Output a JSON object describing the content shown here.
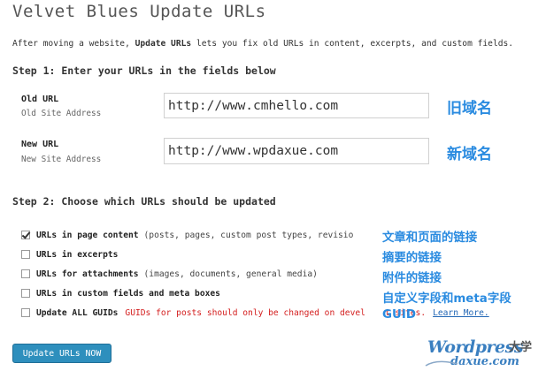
{
  "page": {
    "title": "Velvet Blues Update URLs",
    "intro_prefix": "After moving a website, ",
    "intro_bold": "Update URLs",
    "intro_suffix": " lets you fix old URLs in content, excerpts, and custom fields."
  },
  "step1": {
    "heading": "Step 1: Enter your URLs in the fields below",
    "old_url": {
      "label": "Old URL",
      "sub": "Old Site Address",
      "value": "http://www.cmhello.com",
      "annotation": "旧域名"
    },
    "new_url": {
      "label": "New URL",
      "sub": "New Site Address",
      "value": "http://www.wpdaxue.com",
      "annotation": "新域名"
    }
  },
  "step2": {
    "heading": "Step 2: Choose which URLs should be updated",
    "options": [
      {
        "bold": "URLs in page content",
        "desc": "(posts, pages, custom post types, revisio",
        "checked": true
      },
      {
        "bold": "URLs in excerpts",
        "desc": "",
        "checked": false
      },
      {
        "bold": "URLs for attachments",
        "desc": "(images, documents, general media)",
        "checked": false
      },
      {
        "bold": "URLs in custom fields and meta boxes",
        "desc": "",
        "checked": false
      },
      {
        "bold": "Update ALL GUIDs",
        "desc": "",
        "warn": "GUIDs for posts should only be changed on devel",
        "warn_tail": "t sites.",
        "link": "Learn More.",
        "checked": false
      }
    ],
    "annotations": [
      "文章和页面的链接",
      "摘要的链接",
      "附件的链接",
      "自定义字段和meta字段",
      "GUID"
    ]
  },
  "actions": {
    "submit_label": "Update URLs NOW"
  },
  "watermark": {
    "word1": "Wordpress",
    "word2": "daxue.com",
    "cn": "大学"
  },
  "colors": {
    "annotation": "#2a8be0",
    "button": "#2e8fbd",
    "warning": "#d42020",
    "link": "#2166b5"
  }
}
